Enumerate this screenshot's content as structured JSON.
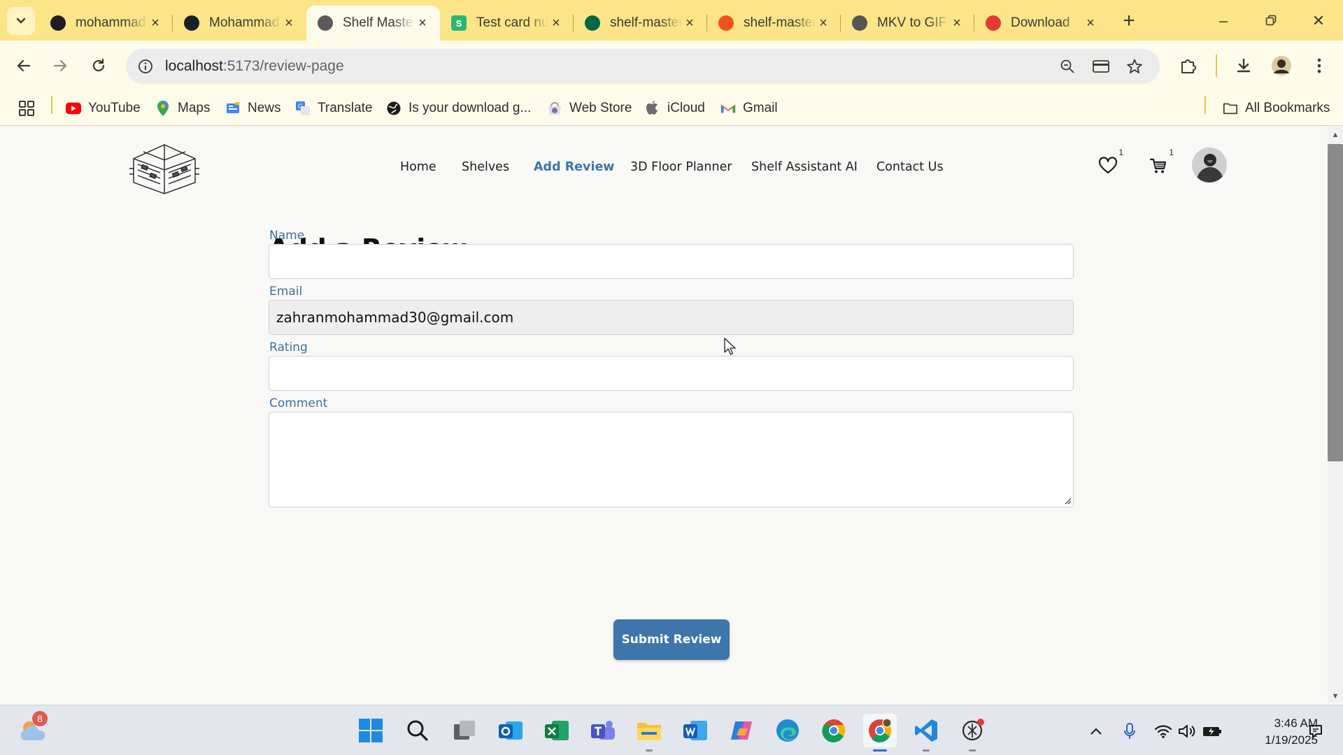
{
  "browser": {
    "tabs": [
      {
        "title": "mohammad",
        "icon": "github-icon",
        "color": "#1b1f23"
      },
      {
        "title": "Mohammad",
        "icon": "github-icon",
        "color": "#1b1f23"
      },
      {
        "title": "Shelf Master",
        "icon": "shelf-logo-icon",
        "color": "#5a5a5a",
        "active": true
      },
      {
        "title": "Test card numbers",
        "icon": "stripe-s-icon",
        "color": "#2bb673"
      },
      {
        "title": "shelf-master",
        "icon": "mongodb-leaf-icon",
        "color": "#00684a"
      },
      {
        "title": "shelf-master",
        "icon": "firebase-flame-icon",
        "color": "#f4511e"
      },
      {
        "title": "MKV to GIF",
        "icon": "cloud-convert-icon",
        "color": "#555555"
      },
      {
        "title": "Download",
        "icon": "download-red-icon",
        "color": "#e53935"
      }
    ],
    "url_host": "localhost",
    "url_path": ":5173/review-page",
    "bookmarks": [
      {
        "label": "YouTube",
        "icon": "youtube-icon"
      },
      {
        "label": "Maps",
        "icon": "maps-pin-icon"
      },
      {
        "label": "News",
        "icon": "google-news-icon"
      },
      {
        "label": "Translate",
        "icon": "google-translate-icon"
      },
      {
        "label": "Is your download g...",
        "icon": "globe-icon"
      },
      {
        "label": "Web Store",
        "icon": "web-store-icon"
      },
      {
        "label": "iCloud",
        "icon": "apple-icon"
      },
      {
        "label": "Gmail",
        "icon": "gmail-icon"
      }
    ],
    "all_bookmarks": "All Bookmarks"
  },
  "site": {
    "nav": [
      {
        "label": "Home",
        "active": false
      },
      {
        "label": "Shelves",
        "active": false
      },
      {
        "label": "Add Review",
        "active": true
      },
      {
        "label": "3D Floor Planner",
        "active": false
      },
      {
        "label": "Shelf Assistant AI",
        "active": false
      },
      {
        "label": "Contact Us",
        "active": false
      }
    ],
    "wishlist_count": "1",
    "cart_count": "1",
    "accent_color": "#3e76ab"
  },
  "form": {
    "title": "Add a Review",
    "name_label": "Name",
    "name_value": "",
    "email_label": "Email",
    "email_value": "zahranmohammad30@gmail.com",
    "rating_label": "Rating",
    "rating_value": "",
    "comment_label": "Comment",
    "comment_value": "",
    "submit_label": "Submit Review"
  },
  "taskbar": {
    "weather_badge": "8",
    "time": "3:46 AM",
    "date": "1/19/2025"
  }
}
